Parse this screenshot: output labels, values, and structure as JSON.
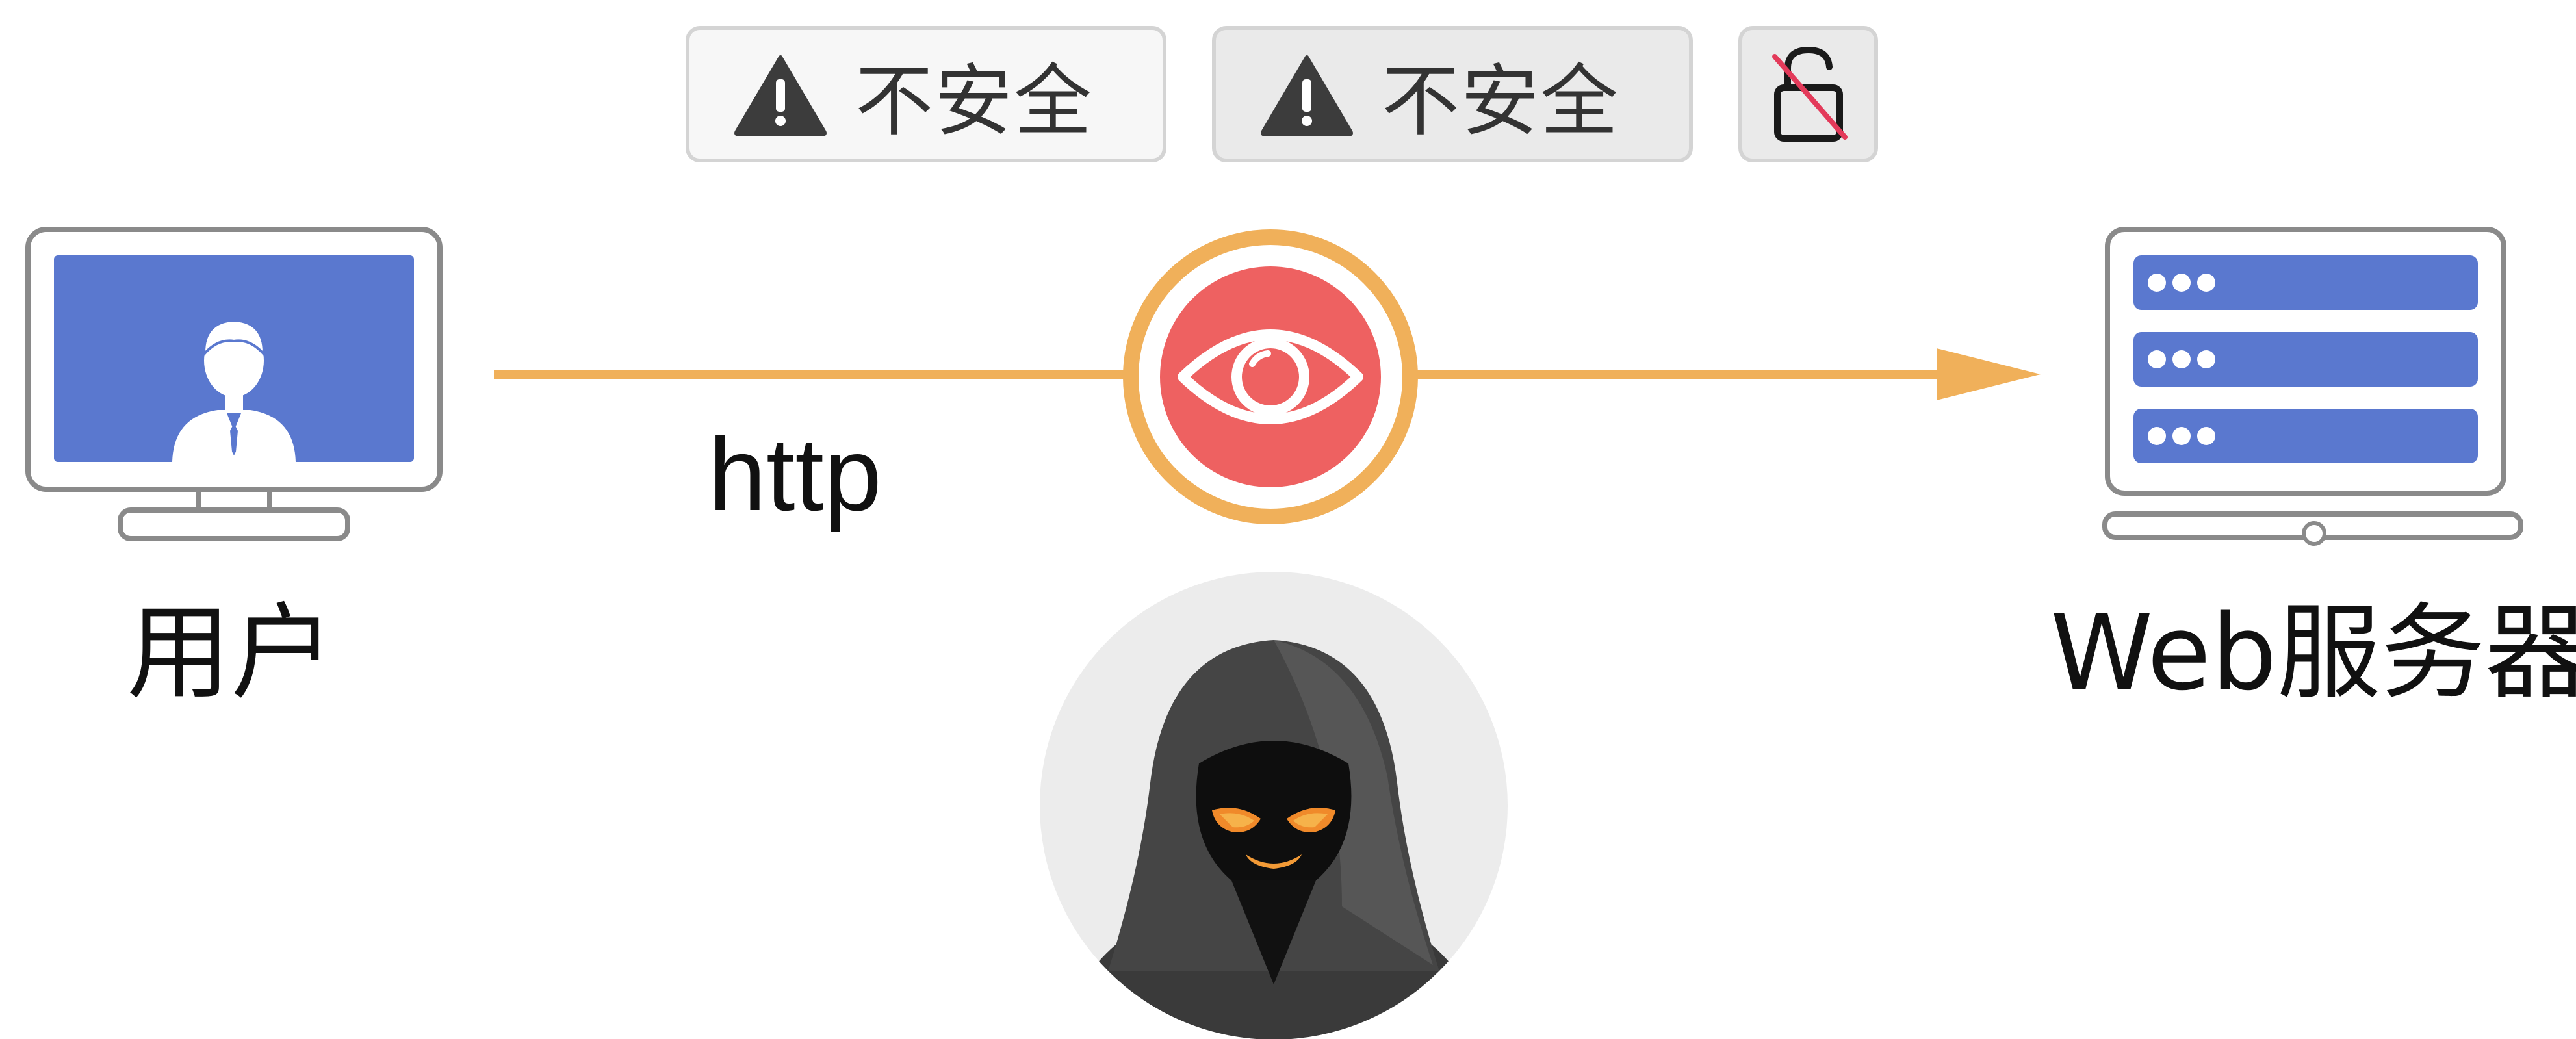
{
  "badges": [
    {
      "icon": "warning-triangle-icon",
      "text": "不安全"
    },
    {
      "icon": "warning-triangle-icon",
      "text": "不安全"
    },
    {
      "icon": "broken-lock-icon",
      "text": ""
    }
  ],
  "user": {
    "label": "用户",
    "icon": "computer-user-icon"
  },
  "connection": {
    "protocol_label": "http",
    "icon": "eye-icon"
  },
  "server": {
    "label": "Web服务器",
    "icon": "server-icon"
  },
  "attacker": {
    "icon": "hooded-hacker-icon"
  },
  "colors": {
    "accent_blue": "#5a78cf",
    "arrow_orange": "#f0b05a",
    "eye_red": "#ee6161",
    "frame_gray": "#8a8a8a"
  }
}
